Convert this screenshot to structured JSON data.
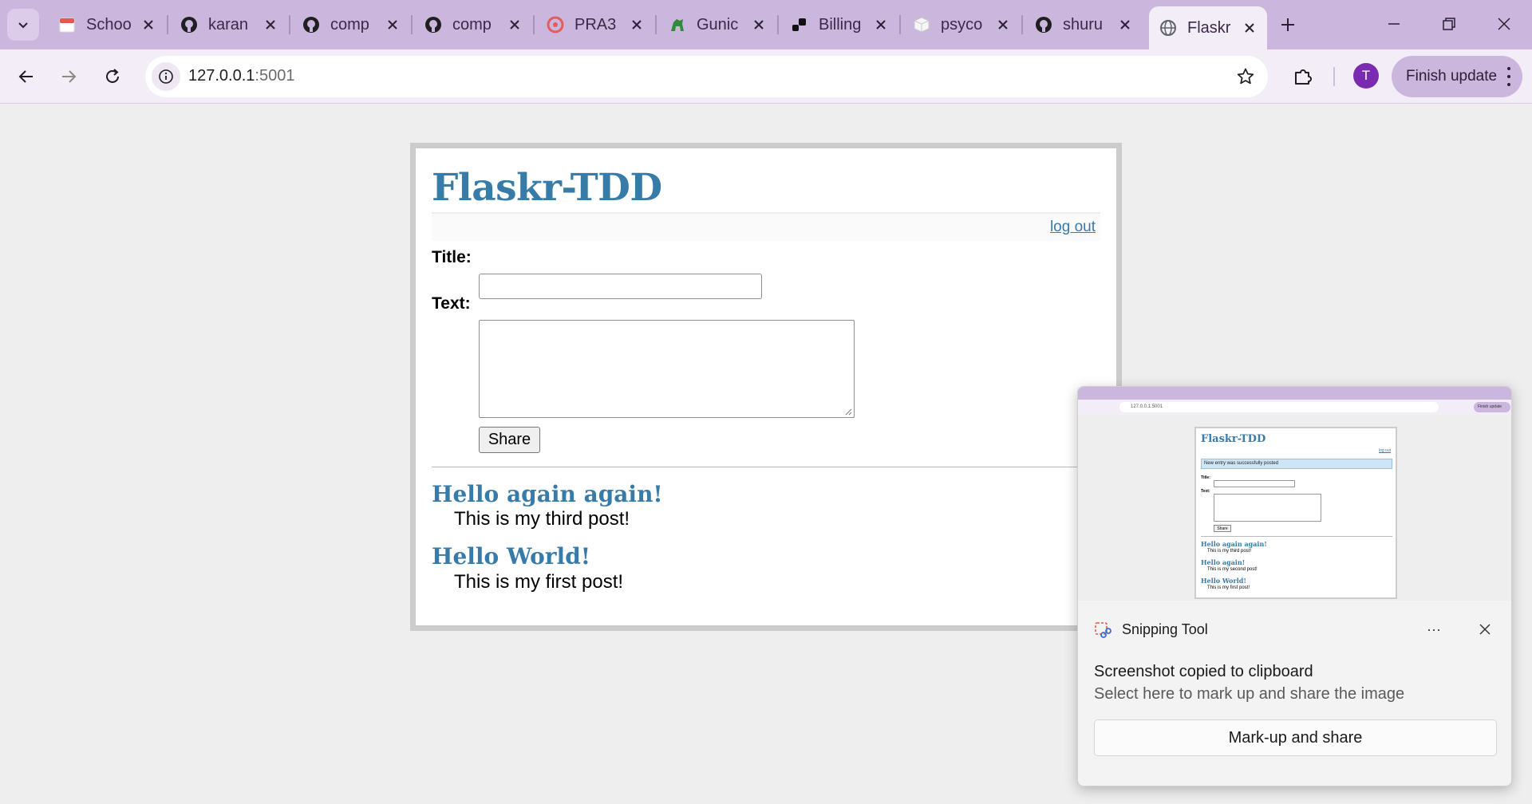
{
  "browser": {
    "tabs": [
      {
        "title": "Schoo",
        "icon": "calendar-icon"
      },
      {
        "title": "karan",
        "icon": "github-icon"
      },
      {
        "title": "comp",
        "icon": "github-icon"
      },
      {
        "title": "comp",
        "icon": "github-icon"
      },
      {
        "title": "PRA3",
        "icon": "openapi-icon"
      },
      {
        "title": "Gunic",
        "icon": "gunicorn-icon"
      },
      {
        "title": "Billing",
        "icon": "billing-icon"
      },
      {
        "title": "psyco",
        "icon": "package-icon"
      },
      {
        "title": "shuru",
        "icon": "github-icon"
      },
      {
        "title": "Flaskr",
        "icon": "globe-icon"
      }
    ],
    "url_host": "127.0.0.1",
    "url_port": ":5001",
    "profile_initial": "T",
    "finish_update": "Finish update",
    "accent": "#cbb6dd"
  },
  "page": {
    "title": "Flaskr-TDD",
    "logout": "log out",
    "title_label": "Title:",
    "text_label": "Text:",
    "title_value": "",
    "text_value": "",
    "share": "Share",
    "link_color": "#377ba8",
    "entries": [
      {
        "title": "Hello again again!",
        "text": "This is my third post!"
      },
      {
        "title": "Hello World!",
        "text": "This is my first post!"
      }
    ]
  },
  "snipping": {
    "app_name": "Snipping Tool",
    "more": "···",
    "message": "Screenshot copied to clipboard",
    "sub": "Select here to mark up and share the image",
    "button": "Mark-up and share",
    "preview": {
      "page_title": "Flaskr-TDD",
      "logout": "log out",
      "flash": "New entry was successfully posted",
      "title_label": "Title:",
      "text_label": "Text:",
      "share": "Share",
      "url": "127.0.0.1:5001",
      "finish_update": "Finish update",
      "entries": [
        {
          "title": "Hello again again!",
          "text": "This is my third post!"
        },
        {
          "title": "Hello again!",
          "text": "This is my second post!"
        },
        {
          "title": "Hello World!",
          "text": "This is my first post!"
        }
      ]
    }
  }
}
